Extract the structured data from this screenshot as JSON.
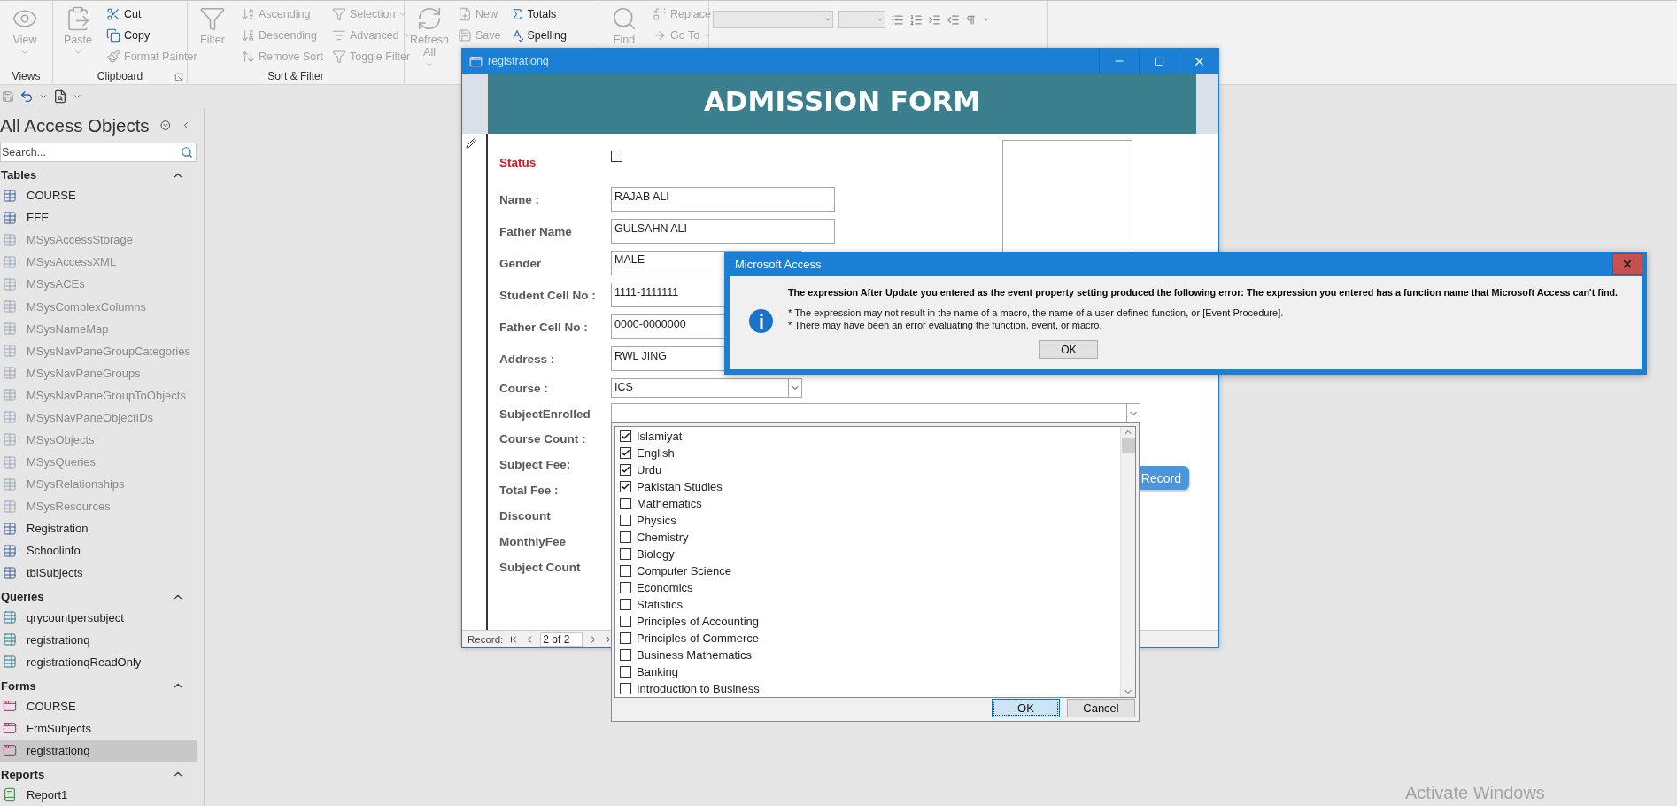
{
  "ribbon": {
    "groups": [
      {
        "kind": "commands",
        "label": "Views",
        "columns": [
          [
            {
              "label": "View",
              "kind": "large",
              "disabled": true,
              "dropdown": true
            }
          ]
        ]
      },
      {
        "kind": "commands",
        "label": "Clipboard",
        "launcher": true,
        "columns": [
          [
            {
              "label": "Paste",
              "kind": "large",
              "disabled": true,
              "dropdown": true
            }
          ],
          [
            {
              "label": "Cut",
              "kind": "small",
              "disabled": false,
              "dropdown": false
            },
            {
              "label": "Copy",
              "kind": "small",
              "disabled": false,
              "dropdown": false
            },
            {
              "label": "Format Painter",
              "kind": "small",
              "disabled": true,
              "dropdown": false
            }
          ]
        ]
      },
      {
        "kind": "commands",
        "label": "Sort & Filter",
        "columns": [
          [
            {
              "label": "Filter",
              "kind": "large",
              "disabled": true,
              "dropdown": false
            }
          ],
          [
            {
              "label": "Ascending",
              "kind": "small",
              "disabled": true,
              "dropdown": false
            },
            {
              "label": "Descending",
              "kind": "small",
              "disabled": true,
              "dropdown": false
            },
            {
              "label": "Remove Sort",
              "kind": "small",
              "disabled": true,
              "dropdown": false
            }
          ],
          [
            {
              "label": "Selection",
              "kind": "small",
              "disabled": true,
              "dropdown": true
            },
            {
              "label": "Advanced",
              "kind": "small",
              "disabled": true,
              "dropdown": true
            },
            {
              "label": "Toggle Filter",
              "kind": "small",
              "disabled": true,
              "dropdown": false
            }
          ]
        ]
      },
      {
        "kind": "commands",
        "columns": [
          [
            {
              "label": "Refresh All",
              "kind": "large",
              "disabled": true,
              "dropdown": true
            }
          ],
          [
            {
              "label": "New",
              "kind": "small",
              "disabled": true,
              "dropdown": false
            },
            {
              "label": "Save",
              "kind": "small",
              "disabled": true,
              "dropdown": false
            }
          ],
          [
            {
              "label": "Totals",
              "kind": "small",
              "disabled": false,
              "dropdown": false
            },
            {
              "label": "Spelling",
              "kind": "small",
              "disabled": false,
              "dropdown": false
            }
          ]
        ]
      },
      {
        "kind": "commands",
        "columns": [
          [
            {
              "label": "Find",
              "kind": "large",
              "disabled": true,
              "dropdown": false
            }
          ],
          [
            {
              "label": "Replace",
              "kind": "small",
              "disabled": true,
              "dropdown": false
            },
            {
              "label": "Go To",
              "kind": "small",
              "disabled": true,
              "dropdown": true
            }
          ]
        ]
      },
      {
        "kind": "formatting"
      }
    ]
  },
  "navigation": {
    "title": "All Access Objects",
    "search": {
      "placeholder": "Search..."
    },
    "groups": [
      {
        "label": "Tables",
        "kind": "table",
        "expanded": true,
        "items": [
          {
            "label": "COURSE",
            "dimmed": false,
            "selected": false
          },
          {
            "label": "FEE",
            "dimmed": false,
            "selected": false
          },
          {
            "label": "MSysAccessStorage",
            "dimmed": true,
            "selected": false
          },
          {
            "label": "MSysAccessXML",
            "dimmed": true,
            "selected": false
          },
          {
            "label": "MSysACEs",
            "dimmed": true,
            "selected": false
          },
          {
            "label": "MSysComplexColumns",
            "dimmed": true,
            "selected": false
          },
          {
            "label": "MSysNameMap",
            "dimmed": true,
            "selected": false
          },
          {
            "label": "MSysNavPaneGroupCategories",
            "dimmed": true,
            "selected": false
          },
          {
            "label": "MSysNavPaneGroups",
            "dimmed": true,
            "selected": false
          },
          {
            "label": "MSysNavPaneGroupToObjects",
            "dimmed": true,
            "selected": false
          },
          {
            "label": "MSysNavPaneObjectIDs",
            "dimmed": true,
            "selected": false
          },
          {
            "label": "MSysObjects",
            "dimmed": true,
            "selected": false
          },
          {
            "label": "MSysQueries",
            "dimmed": true,
            "selected": false
          },
          {
            "label": "MSysRelationships",
            "dimmed": true,
            "selected": false
          },
          {
            "label": "MSysResources",
            "dimmed": true,
            "selected": false
          },
          {
            "label": "Registration",
            "dimmed": false,
            "selected": false
          },
          {
            "label": "Schoolinfo",
            "dimmed": false,
            "selected": false
          },
          {
            "label": "tblSubjects",
            "dimmed": false,
            "selected": false
          }
        ]
      },
      {
        "label": "Queries",
        "kind": "query",
        "expanded": true,
        "items": [
          {
            "label": "qrycountpersubject",
            "dimmed": false,
            "selected": false
          },
          {
            "label": "registrationq",
            "dimmed": false,
            "selected": false
          },
          {
            "label": "registrationqReadOnly",
            "dimmed": false,
            "selected": false
          }
        ]
      },
      {
        "label": "Forms",
        "kind": "form",
        "expanded": true,
        "items": [
          {
            "label": "COURSE",
            "dimmed": false,
            "selected": false
          },
          {
            "label": "FrmSubjects",
            "dimmed": false,
            "selected": false
          },
          {
            "label": "registrationq",
            "dimmed": false,
            "selected": true
          }
        ]
      },
      {
        "label": "Reports",
        "kind": "report",
        "expanded": true,
        "items": [
          {
            "label": "Report1",
            "dimmed": false,
            "selected": false
          }
        ]
      }
    ]
  },
  "form_window": {
    "title": "registrationq",
    "header": "ADMISSION FORM",
    "fields": [
      {
        "label": "Status",
        "kind": "checkbox",
        "checked": false
      },
      {
        "label": "Name :",
        "kind": "text",
        "value": "RAJAB ALI"
      },
      {
        "label": "Father Name",
        "kind": "text",
        "value": "GULSAHN ALI"
      },
      {
        "label": "Gender",
        "kind": "combo",
        "value": "MALE"
      },
      {
        "label": "Student Cell No :",
        "kind": "text",
        "value": "1111-1111111"
      },
      {
        "label": "Father Cell No :",
        "kind": "text",
        "value": "0000-0000000"
      },
      {
        "label": "Address :",
        "kind": "text",
        "value": "RWL JING"
      },
      {
        "label": "Course :",
        "kind": "combo",
        "value": "ICS"
      },
      {
        "label": "SubjectEnrolled",
        "kind": "wide_combo"
      },
      {
        "label": "Course Count :",
        "kind": "label"
      },
      {
        "label": "Subject Fee:",
        "kind": "label"
      },
      {
        "label": "Total Fee :",
        "kind": "label"
      },
      {
        "label": "Discount",
        "kind": "label"
      },
      {
        "label": "MonthlyFee",
        "kind": "label"
      },
      {
        "label": "Subject Count",
        "kind": "label"
      }
    ],
    "record_button": "Record",
    "record_nav": {
      "label": "Record:",
      "position": "2 of 2"
    }
  },
  "subject_list": {
    "items": [
      {
        "label": "Islamiyat",
        "checked": true
      },
      {
        "label": "English",
        "checked": true
      },
      {
        "label": "Urdu",
        "checked": true
      },
      {
        "label": "Pakistan Studies",
        "checked": true
      },
      {
        "label": "Mathematics",
        "checked": false
      },
      {
        "label": "Physics",
        "checked": false
      },
      {
        "label": "Chemistry",
        "checked": false
      },
      {
        "label": "Biology",
        "checked": false
      },
      {
        "label": "Computer Science",
        "checked": false
      },
      {
        "label": "Economics",
        "checked": false
      },
      {
        "label": "Statistics",
        "checked": false
      },
      {
        "label": "Principles of Accounting",
        "checked": false
      },
      {
        "label": "Principles of Commerce",
        "checked": false
      },
      {
        "label": "Business Mathematics",
        "checked": false
      },
      {
        "label": "Banking",
        "checked": false
      },
      {
        "label": "Introduction to Business",
        "checked": false
      }
    ],
    "ok": "OK",
    "cancel": "Cancel"
  },
  "dialog": {
    "title": "Microsoft Access",
    "message": "The expression After Update you entered as the event property setting produced the following error: The expression you entered has a function name that Microsoft Access can't find.",
    "notes": [
      "* The expression may not result in the name of a macro, the name of a user-defined function, or [Event Procedure].",
      "* There may have been an error evaluating the function, event, or macro."
    ],
    "ok": "OK"
  },
  "os_notice": "Activate Windows"
}
